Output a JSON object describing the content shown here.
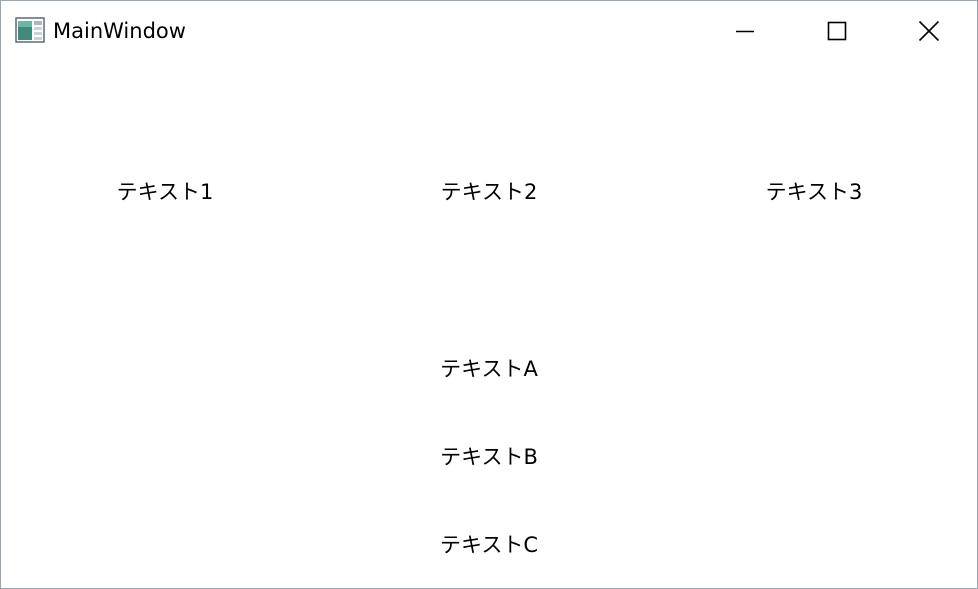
{
  "window": {
    "title": "MainWindow"
  },
  "icons": {
    "app": "app-window-icon",
    "minimize": "minimize-icon",
    "maximize": "maximize-icon",
    "close": "close-icon"
  },
  "top_row": [
    "テキスト1",
    "テキスト2",
    "テキスト3"
  ],
  "column": [
    "テキストA",
    "テキストB",
    "テキストC"
  ]
}
